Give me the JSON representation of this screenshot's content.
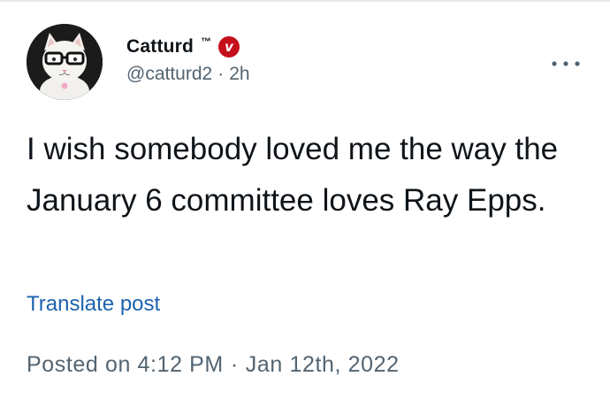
{
  "author": {
    "display_name": "Catturd",
    "trademark": "™",
    "verified_badge_glyph": "v",
    "handle": "@catturd2",
    "separator": "·",
    "relative_time": "2h",
    "avatar_icon": "cat-with-glasses-avatar"
  },
  "menu": {
    "icon": "more-horizontal-icon"
  },
  "post": {
    "text": "I wish somebody loved me the way the January 6 committee loves Ray Epps."
  },
  "translate_label": "Translate post",
  "footer": {
    "posted_prefix": "Posted on",
    "time": "4:12 PM",
    "separator": "·",
    "date": "Jan 12th, 2022"
  },
  "colors": {
    "text": "#0f1419",
    "secondary": "#536471",
    "link": "#1d62ae",
    "badge": "#c4101a"
  }
}
